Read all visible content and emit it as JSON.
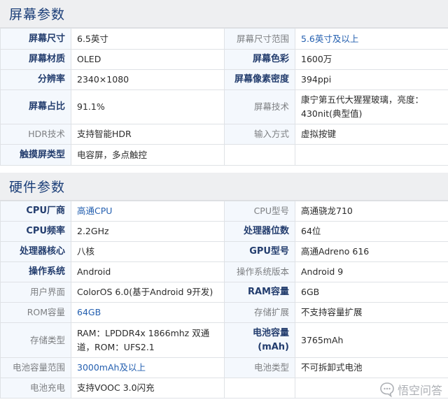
{
  "screen_section": {
    "title": "屏幕参数",
    "rows": [
      {
        "l1": "屏幕尺寸",
        "v1": "6.5英寸",
        "l2": "屏幕尺寸范围",
        "v2": "5.6英寸及以上"
      },
      {
        "l1": "屏幕材质",
        "v1": "OLED",
        "l2": "屏幕色彩",
        "v2": "1600万"
      },
      {
        "l1": "分辨率",
        "v1": "2340×1080",
        "l2": "屏幕像素密度",
        "v2": "394ppi"
      },
      {
        "l1": "屏幕占比",
        "v1": "91.1%",
        "l2": "屏幕技术",
        "v2": "康宁第五代大猩猩玻璃，亮度：430nit(典型值)"
      },
      {
        "l1": "HDR技术",
        "v1": "支持智能HDR",
        "l2": "输入方式",
        "v2": "虚拟按键"
      },
      {
        "l1": "触摸屏类型",
        "v1": "电容屏，多点触控",
        "l2": "",
        "v2": ""
      }
    ]
  },
  "hardware_section": {
    "title": "硬件参数",
    "rows": [
      {
        "l1": "CPU厂商",
        "v1": "高通CPU",
        "l2": "CPU型号",
        "v2": "高通骁龙710"
      },
      {
        "l1": "CPU频率",
        "v1": "2.2GHz",
        "l2": "处理器位数",
        "v2": "64位"
      },
      {
        "l1": "处理器核心",
        "v1": "八核",
        "l2": "GPU型号",
        "v2": "高通Adreno 616"
      },
      {
        "l1": "操作系统",
        "v1": "Android",
        "l2": "操作系统版本",
        "v2": "Android 9"
      },
      {
        "l1": "用户界面",
        "v1": "ColorOS 6.0(基于Android 9开发)",
        "l2": "RAM容量",
        "v2": "6GB"
      },
      {
        "l1": "ROM容量",
        "v1": "64GB",
        "l2": "存储扩展",
        "v2": "不支持容量扩展"
      },
      {
        "l1": "存储类型",
        "v1": "RAM：LPDDR4x 1866mhz 双通道，ROM：UFS2.1",
        "l2": "电池容量(mAh)",
        "v2": "3765mAh"
      },
      {
        "l1": "电池容量范围",
        "v1": "3000mAh及以上",
        "l2": "电池类型",
        "v2": "不可拆卸式电池"
      },
      {
        "l1": "电池充电",
        "v1": "支持VOOC 3.0闪充",
        "l2": "",
        "v2": ""
      }
    ]
  },
  "watermark": {
    "text": "悟空问答"
  },
  "colors": {
    "bold_label": "#233d6e",
    "link_value": "#2560b0",
    "label_bg": "#f4f8fd"
  }
}
